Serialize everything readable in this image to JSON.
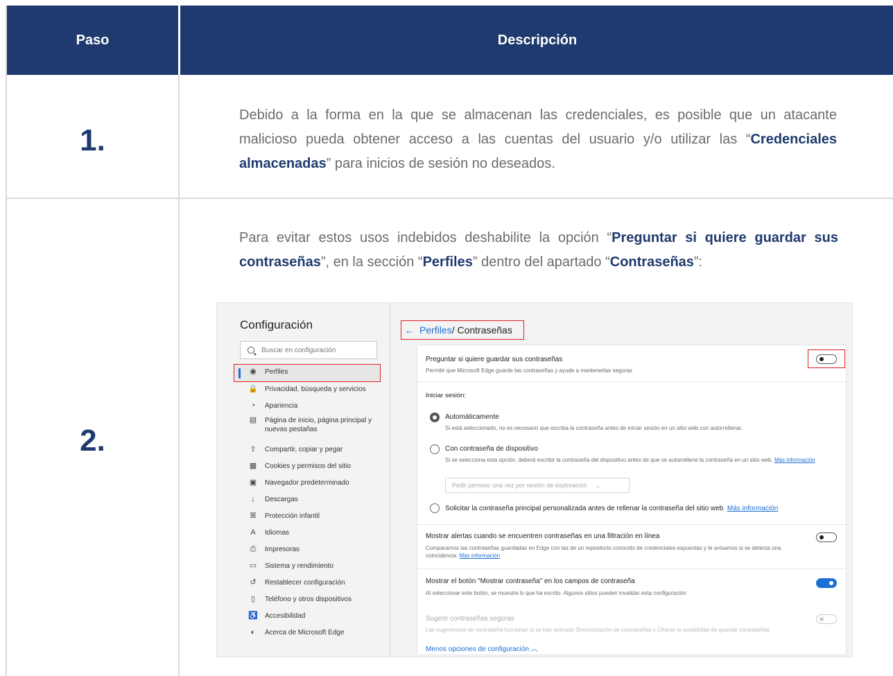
{
  "table": {
    "header": {
      "col1": "Paso",
      "col2": "Descripción"
    },
    "rows": [
      {
        "step": "1.",
        "text_a": "Debido a la forma en la que se almacenan las credenciales, es posible que un atacante malicioso pueda obtener acceso a las cuentas del usuario y/o utilizar las “",
        "bold_a": "Credenciales almacenadas",
        "text_b": "” para inicios de sesión no deseados."
      },
      {
        "step": "2.",
        "text_a": "Para evitar estos usos indebidos deshabilite la opción “",
        "bold_a": "Preguntar si quiere guardar sus contraseñas",
        "text_b": "”, en la sección “",
        "bold_b": "Perfiles",
        "text_c": "” dentro del apartado “",
        "bold_c": "Contraseñas",
        "text_d": "”:"
      }
    ]
  },
  "screenshot": {
    "sidebar": {
      "title": "Configuración",
      "search_placeholder": "Buscar en configuración",
      "items": [
        {
          "icon": "profile-icon",
          "glyph": "◉",
          "label": "Perfiles"
        },
        {
          "icon": "lock-icon",
          "glyph": "🔒",
          "label": "Privacidad, búsqueda y servicios"
        },
        {
          "icon": "palette-icon",
          "glyph": "◔",
          "label": "Apariencia"
        },
        {
          "icon": "home-icon",
          "glyph": "▤",
          "label": "Página de inicio, página principal y nuevas pestañas"
        },
        {
          "icon": "share-icon",
          "glyph": "⇪",
          "label": "Compartir, copiar y pegar"
        },
        {
          "icon": "cookie-icon",
          "glyph": "▦",
          "label": "Cookies y permisos del sitio"
        },
        {
          "icon": "browser-icon",
          "glyph": "▣",
          "label": "Navegador predeterminado"
        },
        {
          "icon": "download-icon",
          "glyph": "↓",
          "label": "Descargas"
        },
        {
          "icon": "family-icon",
          "glyph": "ꕤ",
          "label": "Protección infantil"
        },
        {
          "icon": "language-icon",
          "glyph": "A",
          "label": "Idiomas"
        },
        {
          "icon": "printer-icon",
          "glyph": "⎙",
          "label": "Impresoras"
        },
        {
          "icon": "system-icon",
          "glyph": "▭",
          "label": "Sistema y rendimiento"
        },
        {
          "icon": "reset-icon",
          "glyph": "↺",
          "label": "Restablecer configuración"
        },
        {
          "icon": "phone-icon",
          "glyph": "▯",
          "label": "Teléfono y otros dispositivos"
        },
        {
          "icon": "accessibility-icon",
          "glyph": "♿",
          "label": "Accesibilidad"
        },
        {
          "icon": "edge-icon",
          "glyph": "◐",
          "label": "Acerca de Microsoft Edge"
        }
      ]
    },
    "main": {
      "back_glyph": "←",
      "crumb_link": "Perfiles",
      "crumb_rest": " / Contraseñas",
      "offer_title": "Preguntar si quiere guardar sus contraseñas",
      "offer_sub": "Permitir que Microsoft Edge guarde las contraseñas y ayude a mantenerlas seguras",
      "offer_toggle": "off",
      "signin_label": "Iniciar sesión:",
      "auto_title": "Automáticamente",
      "auto_sub": "Si está seleccionado, no es necesario que escriba la contraseña antes de iniciar sesión en un sitio web con autorrellenar.",
      "device_title": "Con contraseña de dispositivo",
      "device_sub": "Si se selecciona esta opción, deberá escribir la contraseña del dispositivo antes de que se autorrellene la contraseña en un sitio web.",
      "device_more": "Más información",
      "device_dropdown": "Pedir permiso una vez por sesión de exploración",
      "custom_title": "Solicitar la contraseña principal personalizada antes de rellenar la contraseña del sitio web",
      "custom_more": "Más información",
      "leak_title": "Mostrar alertas cuando se encuentren contraseñas en una filtración en línea",
      "leak_sub": "Comparamos las contraseñas guardadas en Edge con las de un repositorio conocido de credenciales expuestas y le avisamos si se detecta una coincidencia.",
      "leak_more": "Más información",
      "leak_toggle": "off",
      "reveal_title": "Mostrar el botón \"Mostrar contraseña\" en los campos de contraseña",
      "reveal_sub": "Al seleccionar este botón, se muestra lo que ha escrito. Algunos sitios pueden invalidar esta configuración",
      "reveal_toggle": "on",
      "suggest_title": "Sugerir contraseñas seguras",
      "suggest_sub": "Las sugerencias de contraseña funcionan si se han activado Sincronización de contraseñas y Ofrecer la posibilidad de guardar contraseñas",
      "suggest_toggle": "disabled",
      "fewer_options": "Menos opciones de configuración"
    }
  }
}
